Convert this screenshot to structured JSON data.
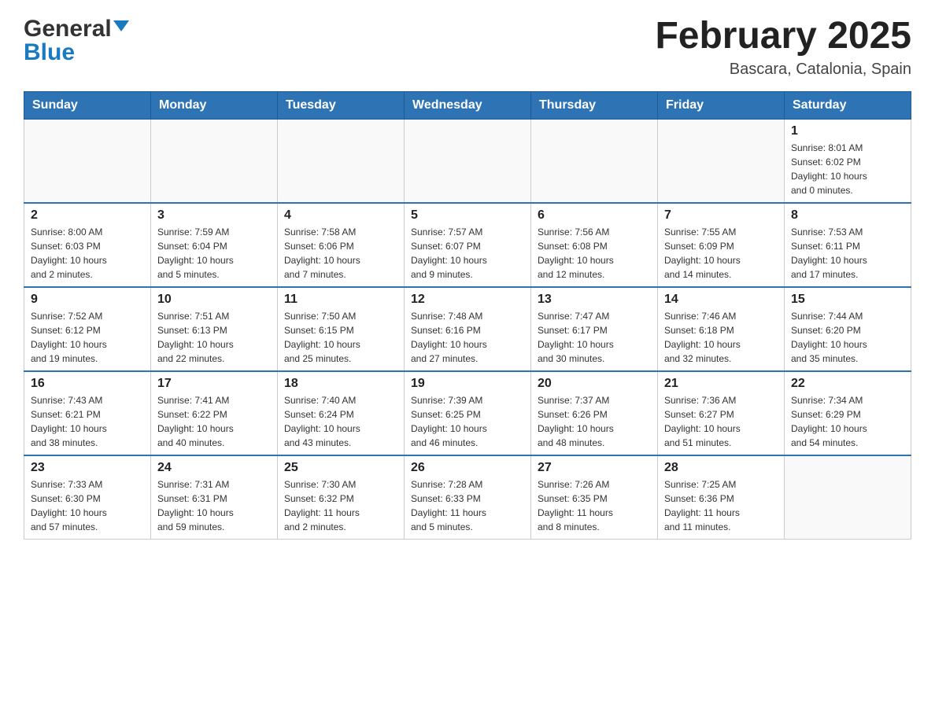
{
  "header": {
    "logo_general": "General",
    "logo_blue": "Blue",
    "month_title": "February 2025",
    "location": "Bascara, Catalonia, Spain"
  },
  "weekdays": [
    "Sunday",
    "Monday",
    "Tuesday",
    "Wednesday",
    "Thursday",
    "Friday",
    "Saturday"
  ],
  "weeks": [
    [
      {
        "day": "",
        "info": ""
      },
      {
        "day": "",
        "info": ""
      },
      {
        "day": "",
        "info": ""
      },
      {
        "day": "",
        "info": ""
      },
      {
        "day": "",
        "info": ""
      },
      {
        "day": "",
        "info": ""
      },
      {
        "day": "1",
        "info": "Sunrise: 8:01 AM\nSunset: 6:02 PM\nDaylight: 10 hours\nand 0 minutes."
      }
    ],
    [
      {
        "day": "2",
        "info": "Sunrise: 8:00 AM\nSunset: 6:03 PM\nDaylight: 10 hours\nand 2 minutes."
      },
      {
        "day": "3",
        "info": "Sunrise: 7:59 AM\nSunset: 6:04 PM\nDaylight: 10 hours\nand 5 minutes."
      },
      {
        "day": "4",
        "info": "Sunrise: 7:58 AM\nSunset: 6:06 PM\nDaylight: 10 hours\nand 7 minutes."
      },
      {
        "day": "5",
        "info": "Sunrise: 7:57 AM\nSunset: 6:07 PM\nDaylight: 10 hours\nand 9 minutes."
      },
      {
        "day": "6",
        "info": "Sunrise: 7:56 AM\nSunset: 6:08 PM\nDaylight: 10 hours\nand 12 minutes."
      },
      {
        "day": "7",
        "info": "Sunrise: 7:55 AM\nSunset: 6:09 PM\nDaylight: 10 hours\nand 14 minutes."
      },
      {
        "day": "8",
        "info": "Sunrise: 7:53 AM\nSunset: 6:11 PM\nDaylight: 10 hours\nand 17 minutes."
      }
    ],
    [
      {
        "day": "9",
        "info": "Sunrise: 7:52 AM\nSunset: 6:12 PM\nDaylight: 10 hours\nand 19 minutes."
      },
      {
        "day": "10",
        "info": "Sunrise: 7:51 AM\nSunset: 6:13 PM\nDaylight: 10 hours\nand 22 minutes."
      },
      {
        "day": "11",
        "info": "Sunrise: 7:50 AM\nSunset: 6:15 PM\nDaylight: 10 hours\nand 25 minutes."
      },
      {
        "day": "12",
        "info": "Sunrise: 7:48 AM\nSunset: 6:16 PM\nDaylight: 10 hours\nand 27 minutes."
      },
      {
        "day": "13",
        "info": "Sunrise: 7:47 AM\nSunset: 6:17 PM\nDaylight: 10 hours\nand 30 minutes."
      },
      {
        "day": "14",
        "info": "Sunrise: 7:46 AM\nSunset: 6:18 PM\nDaylight: 10 hours\nand 32 minutes."
      },
      {
        "day": "15",
        "info": "Sunrise: 7:44 AM\nSunset: 6:20 PM\nDaylight: 10 hours\nand 35 minutes."
      }
    ],
    [
      {
        "day": "16",
        "info": "Sunrise: 7:43 AM\nSunset: 6:21 PM\nDaylight: 10 hours\nand 38 minutes."
      },
      {
        "day": "17",
        "info": "Sunrise: 7:41 AM\nSunset: 6:22 PM\nDaylight: 10 hours\nand 40 minutes."
      },
      {
        "day": "18",
        "info": "Sunrise: 7:40 AM\nSunset: 6:24 PM\nDaylight: 10 hours\nand 43 minutes."
      },
      {
        "day": "19",
        "info": "Sunrise: 7:39 AM\nSunset: 6:25 PM\nDaylight: 10 hours\nand 46 minutes."
      },
      {
        "day": "20",
        "info": "Sunrise: 7:37 AM\nSunset: 6:26 PM\nDaylight: 10 hours\nand 48 minutes."
      },
      {
        "day": "21",
        "info": "Sunrise: 7:36 AM\nSunset: 6:27 PM\nDaylight: 10 hours\nand 51 minutes."
      },
      {
        "day": "22",
        "info": "Sunrise: 7:34 AM\nSunset: 6:29 PM\nDaylight: 10 hours\nand 54 minutes."
      }
    ],
    [
      {
        "day": "23",
        "info": "Sunrise: 7:33 AM\nSunset: 6:30 PM\nDaylight: 10 hours\nand 57 minutes."
      },
      {
        "day": "24",
        "info": "Sunrise: 7:31 AM\nSunset: 6:31 PM\nDaylight: 10 hours\nand 59 minutes."
      },
      {
        "day": "25",
        "info": "Sunrise: 7:30 AM\nSunset: 6:32 PM\nDaylight: 11 hours\nand 2 minutes."
      },
      {
        "day": "26",
        "info": "Sunrise: 7:28 AM\nSunset: 6:33 PM\nDaylight: 11 hours\nand 5 minutes."
      },
      {
        "day": "27",
        "info": "Sunrise: 7:26 AM\nSunset: 6:35 PM\nDaylight: 11 hours\nand 8 minutes."
      },
      {
        "day": "28",
        "info": "Sunrise: 7:25 AM\nSunset: 6:36 PM\nDaylight: 11 hours\nand 11 minutes."
      },
      {
        "day": "",
        "info": ""
      }
    ]
  ]
}
